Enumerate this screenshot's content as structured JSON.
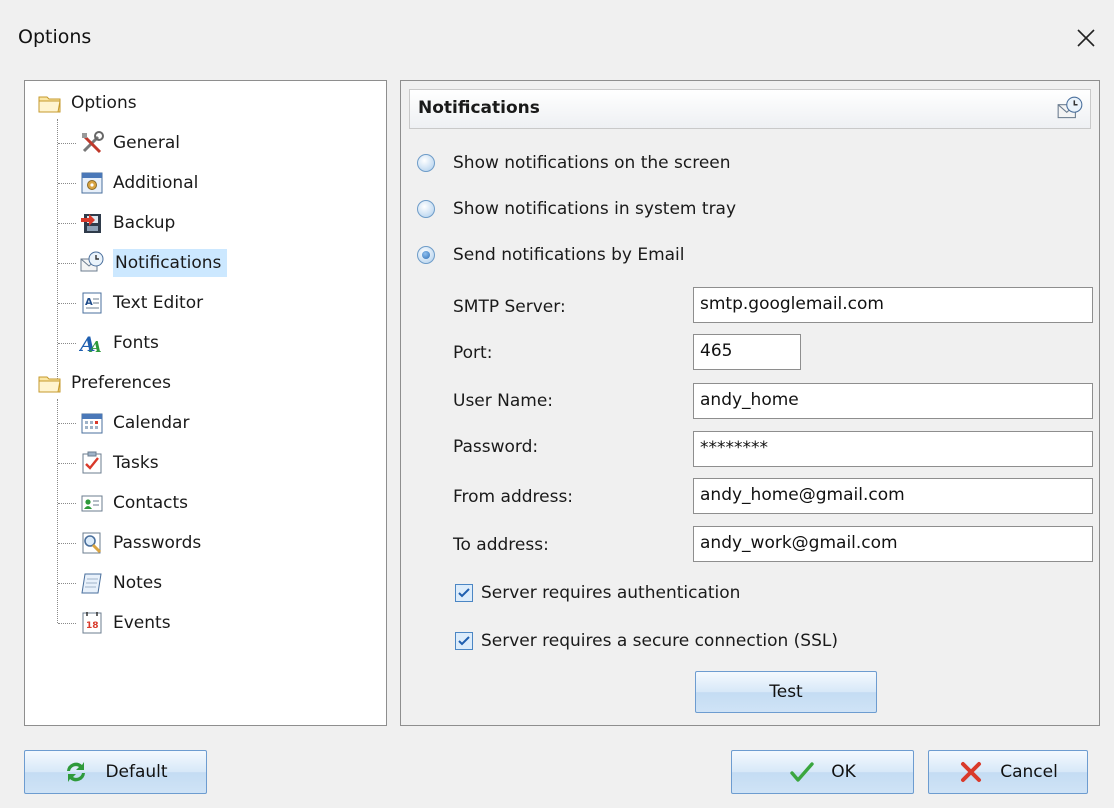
{
  "window": {
    "title": "Options"
  },
  "tree": {
    "groups": [
      {
        "label": "Options",
        "icon": "folder-icon",
        "children": [
          {
            "label": "General",
            "icon": "tools-icon"
          },
          {
            "label": "Additional",
            "icon": "settings-panel-icon"
          },
          {
            "label": "Backup",
            "icon": "backup-icon"
          },
          {
            "label": "Notifications",
            "icon": "notifications-icon",
            "selected": true
          },
          {
            "label": "Text Editor",
            "icon": "text-editor-icon"
          },
          {
            "label": "Fonts",
            "icon": "fonts-icon"
          }
        ]
      },
      {
        "label": "Preferences",
        "icon": "folder-icon",
        "children": [
          {
            "label": "Calendar",
            "icon": "calendar-icon"
          },
          {
            "label": "Tasks",
            "icon": "tasks-icon"
          },
          {
            "label": "Contacts",
            "icon": "contacts-icon"
          },
          {
            "label": "Passwords",
            "icon": "passwords-icon"
          },
          {
            "label": "Notes",
            "icon": "notes-icon"
          },
          {
            "label": "Events",
            "icon": "events-icon"
          }
        ]
      }
    ]
  },
  "panel": {
    "title": "Notifications",
    "radio": {
      "screen": "Show notifications on the screen",
      "tray": "Show notifications in system tray",
      "email": "Send notifications by Email",
      "selected": "email"
    },
    "fields": {
      "smtp_label": "SMTP Server:",
      "smtp_value": "smtp.googlemail.com",
      "port_label": "Port:",
      "port_value": "465",
      "user_label": "User Name:",
      "user_value": "andy_home",
      "password_label": "Password:",
      "password_value": "********",
      "from_label": "From address:",
      "from_value": "andy_home@gmail.com",
      "to_label": "To address:",
      "to_value": "andy_work@gmail.com"
    },
    "checks": {
      "auth_label": "Server requires authentication",
      "auth_checked": true,
      "ssl_label": "Server requires a secure connection (SSL)",
      "ssl_checked": true
    },
    "test_label": "Test"
  },
  "buttons": {
    "default_label": "Default",
    "ok_label": "OK",
    "cancel_label": "Cancel"
  },
  "colors": {
    "selection": "#cce8ff",
    "button_border": "#6d9cd0",
    "radio_selected": "#2f6fb6"
  }
}
